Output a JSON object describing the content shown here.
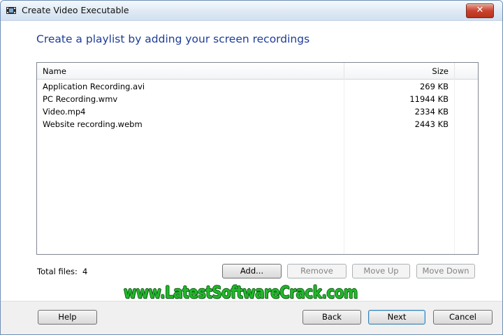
{
  "window": {
    "title": "Create Video Executable"
  },
  "icons": {
    "app": "film-strip-icon",
    "close": "close-x-icon"
  },
  "close_label": "✕",
  "heading": "Create a playlist by adding your screen recordings",
  "list": {
    "columns": {
      "name": "Name",
      "size": "Size"
    },
    "rows": [
      {
        "name": "Application Recording.avi",
        "size": "269 KB"
      },
      {
        "name": "PC Recording.wmv",
        "size": "11944 KB"
      },
      {
        "name": "Video.mp4",
        "size": "2334 KB"
      },
      {
        "name": "Website recording.webm",
        "size": "2443 KB"
      }
    ]
  },
  "total": {
    "label": "Total files:",
    "value": "4"
  },
  "actions": {
    "add": "Add...",
    "remove": "Remove",
    "move_up": "Move Up",
    "move_down": "Move Down"
  },
  "footer": {
    "help": "Help",
    "back": "Back",
    "next": "Next",
    "cancel": "Cancel"
  },
  "watermark": "www.LatestSoftwareCrack.com",
  "colors": {
    "heading": "#1e3c96",
    "watermark": "#21b82a",
    "close": "#c8432e"
  }
}
